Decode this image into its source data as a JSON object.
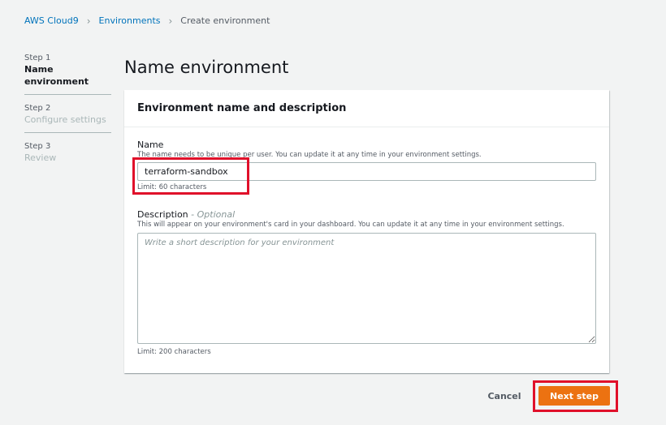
{
  "breadcrumb": {
    "items": [
      "AWS Cloud9",
      "Environments",
      "Create environment"
    ]
  },
  "steps": [
    {
      "num": "Step 1",
      "label": "Name environment",
      "active": true
    },
    {
      "num": "Step 2",
      "label": "Configure settings",
      "active": false
    },
    {
      "num": "Step 3",
      "label": "Review",
      "active": false
    }
  ],
  "page_title": "Name environment",
  "panel": {
    "header": "Environment name and description",
    "name": {
      "label": "Name",
      "description": "The name needs to be unique per user. You can update it at any time in your environment settings.",
      "value": "terraform-sandbox",
      "limit": "Limit: 60 characters"
    },
    "description": {
      "label": "Description",
      "optional": "- Optional",
      "description": "This will appear on your environment's card in your dashboard. You can update it at any time in your environment settings.",
      "placeholder": "Write a short description for your environment",
      "limit": "Limit: 200 characters"
    }
  },
  "footer": {
    "cancel_label": "Cancel",
    "next_label": "Next step"
  },
  "colors": {
    "link": "#0073bb",
    "primary_button": "#ec7211",
    "highlight": "#e0102a"
  }
}
